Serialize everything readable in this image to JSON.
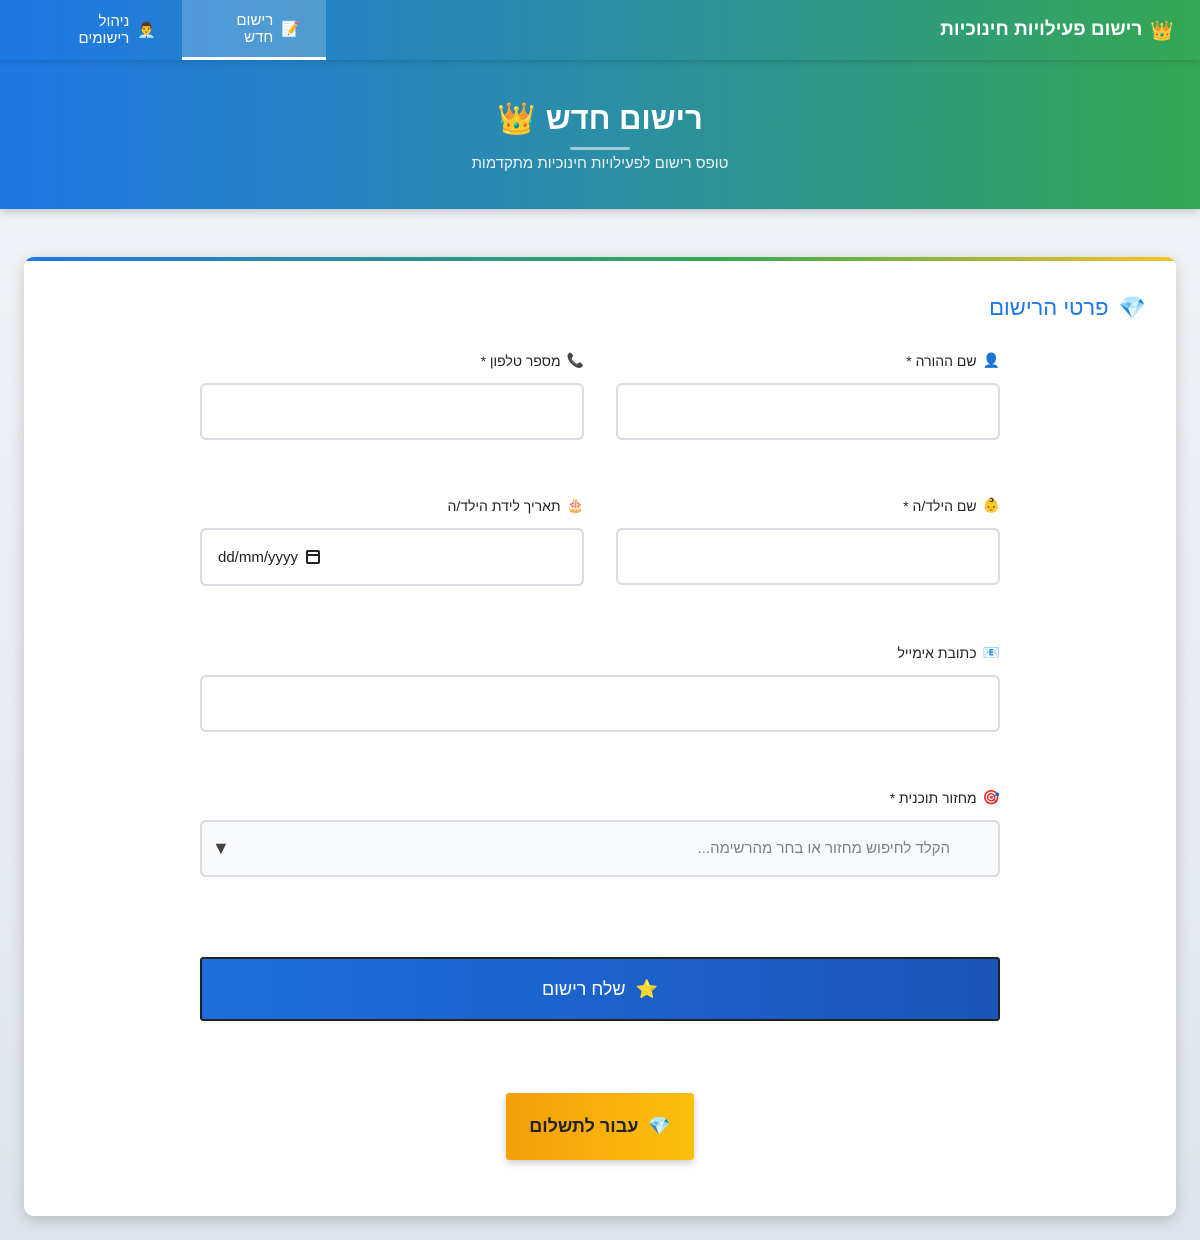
{
  "topbar": {
    "brand_icon": "👑",
    "brand": "רישום פעילויות חינוכיות",
    "tabs": [
      {
        "icon": "📝",
        "label": "רישום חדש",
        "active": true
      },
      {
        "icon": "👨‍💼",
        "label": "ניהול רישומים",
        "active": false
      }
    ]
  },
  "hero": {
    "icon": "👑",
    "title": "רישום חדש",
    "subtitle": "טופס רישום לפעילויות חינוכיות מתקדמות"
  },
  "form": {
    "section_icon": "💎",
    "section_title": "פרטי הרישום",
    "parent_name": {
      "icon": "👤",
      "label": "שם ההורה *",
      "value": ""
    },
    "phone": {
      "icon": "📞",
      "label": "מספר טלפון *",
      "value": ""
    },
    "child_name": {
      "icon": "👶",
      "label": "שם הילד/ה *",
      "value": ""
    },
    "birth_date": {
      "icon": "🎂",
      "label": "תאריך לידת הילד/ה",
      "value": "dd/mm/yyyy"
    },
    "email": {
      "icon": "📧",
      "label": "כתובת אימייל",
      "value": ""
    },
    "cycle": {
      "icon": "🎯",
      "label": "מחזור תוכנית *",
      "placeholder": "הקלד לחיפוש מחזור או בחר מהרשימה...",
      "caret": "▼"
    },
    "submit": {
      "icon": "⭐",
      "label": "שלח רישום"
    },
    "payment": {
      "icon": "💎",
      "label": "עבור לתשלום"
    }
  },
  "colors": {
    "primary": "#1e78e6",
    "green": "#34a853",
    "gold": "#f7c325"
  }
}
